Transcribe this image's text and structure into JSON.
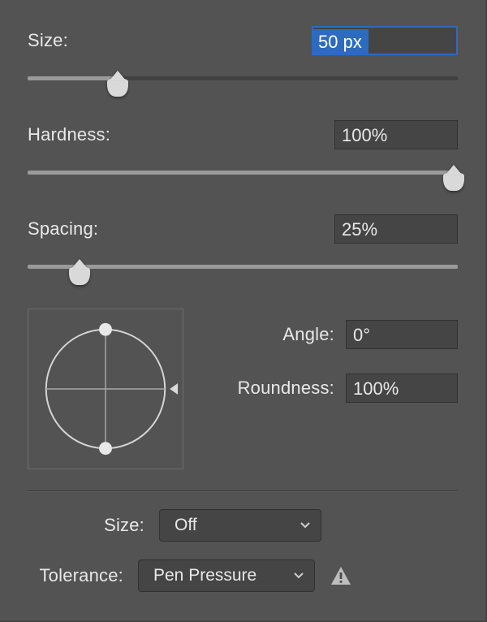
{
  "size": {
    "label": "Size:",
    "value": "50 px",
    "field_width": 180,
    "slider_percent": 21
  },
  "hardness": {
    "label": "Hardness:",
    "value": "100%",
    "field_width": 152,
    "slider_percent": 99
  },
  "spacing": {
    "label": "Spacing:",
    "value": "25%",
    "field_width": 152,
    "slider_percent": 12
  },
  "angle": {
    "label": "Angle:",
    "value": "0°",
    "field_width": 138
  },
  "roundness": {
    "label": "Roundness:",
    "value": "100%",
    "field_width": 138
  },
  "dyn_size": {
    "label": "Size:",
    "value": "Off",
    "select_width": 200
  },
  "tolerance": {
    "label": "Tolerance:",
    "value": "Pen Pressure",
    "select_width": 218,
    "warning": true
  },
  "colors": {
    "selection": "#2d6bc0"
  }
}
